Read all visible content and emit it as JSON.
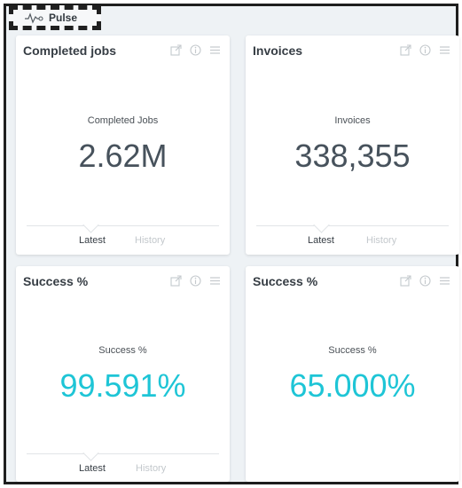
{
  "pulse": {
    "label": "Pulse"
  },
  "cards": [
    {
      "title": "Completed jobs",
      "metric_label": "Completed Jobs",
      "value": "2.62M",
      "tabs": [
        "Latest",
        "History"
      ]
    },
    {
      "title": "Invoices",
      "metric_label": "Invoices",
      "value": "338,355",
      "tabs": [
        "Latest",
        "History"
      ]
    },
    {
      "title": "Success %",
      "metric_label": "Success %",
      "value": "99.591%",
      "tabs": [
        "Latest",
        "History"
      ]
    },
    {
      "title": "Success %",
      "metric_label": "Success %",
      "value": "65.000%"
    }
  ],
  "colors": {
    "accent": "#1ec5d6",
    "value_dark": "#47525c",
    "frame_border": "#1e1e1e"
  }
}
